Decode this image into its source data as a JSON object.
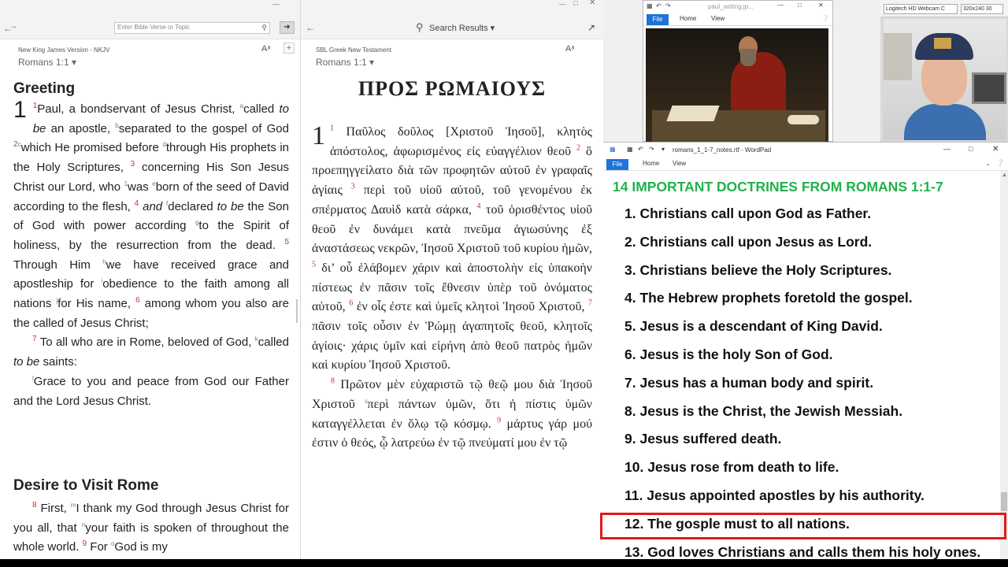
{
  "nkjv": {
    "search_placeholder": "Enter Bible Verse or Topic",
    "version": "New King James Version - NKJV",
    "reference": "Romans 1:1 ▾",
    "font_icon": "Aᵃ",
    "heading1": "Greeting",
    "heading2": "Desire to Visit Rome",
    "chapter": "1",
    "p1": [
      {
        "t": "vn",
        "v": "1"
      },
      {
        "t": "s",
        "v": "Paul, a bondservant of Jesus Christ, "
      },
      {
        "t": "fn",
        "v": "a"
      },
      {
        "t": "s",
        "v": "called "
      },
      {
        "t": "i",
        "v": "to be"
      },
      {
        "t": "s",
        "v": " an apostle, "
      },
      {
        "t": "fn",
        "v": "b"
      },
      {
        "t": "s",
        "v": "separated to the gospel of God "
      },
      {
        "t": "vn",
        "v": "2"
      },
      {
        "t": "fn",
        "v": "c"
      },
      {
        "t": "s",
        "v": "which He promised before "
      },
      {
        "t": "fn",
        "v": "d"
      },
      {
        "t": "s",
        "v": "through His prophets in the Holy Scriptures, "
      },
      {
        "t": "vn",
        "v": "3"
      },
      {
        "t": "s",
        "v": " concerning His Son Jesus Christ our Lord, who "
      },
      {
        "t": "fn",
        "v": "1"
      },
      {
        "t": "s",
        "v": "was "
      },
      {
        "t": "fn",
        "v": "e"
      },
      {
        "t": "s",
        "v": "born of the seed of David according to the flesh, "
      },
      {
        "t": "vn",
        "v": "4"
      },
      {
        "t": "i",
        "v": " and "
      },
      {
        "t": "fn",
        "v": "f"
      },
      {
        "t": "s",
        "v": "declared "
      },
      {
        "t": "i",
        "v": "to be"
      },
      {
        "t": "s",
        "v": " the Son of God with power according "
      },
      {
        "t": "fn",
        "v": "g"
      },
      {
        "t": "s",
        "v": "to the Spirit of holiness, by the resurrection from the dead. "
      },
      {
        "t": "vn",
        "v": "5"
      },
      {
        "t": "s",
        "v": " Through Him "
      },
      {
        "t": "fn",
        "v": "h"
      },
      {
        "t": "s",
        "v": "we have received grace and apostleship for "
      },
      {
        "t": "fn",
        "v": "i"
      },
      {
        "t": "s",
        "v": "obedience to the faith among all nations "
      },
      {
        "t": "fn",
        "v": "j"
      },
      {
        "t": "s",
        "v": "for His name, "
      },
      {
        "t": "vn",
        "v": "6"
      },
      {
        "t": "s",
        "v": " among whom you also are the called of Jesus Christ;"
      }
    ],
    "p2": [
      {
        "t": "vn",
        "v": "7"
      },
      {
        "t": "s",
        "v": " To all who are in Rome, beloved of God, "
      },
      {
        "t": "fn",
        "v": "k"
      },
      {
        "t": "s",
        "v": "called "
      },
      {
        "t": "i",
        "v": "to be"
      },
      {
        "t": "s",
        "v": " saints:"
      }
    ],
    "p3": [
      {
        "t": "fn",
        "v": "l"
      },
      {
        "t": "s",
        "v": "Grace to you and peace from God our Father and the Lord Jesus Christ."
      }
    ],
    "p4": [
      {
        "t": "vn",
        "v": "8"
      },
      {
        "t": "s",
        "v": " First, "
      },
      {
        "t": "fn",
        "v": "m"
      },
      {
        "t": "s",
        "v": "I thank my God through Jesus Christ for you all, that "
      },
      {
        "t": "fn",
        "v": "n"
      },
      {
        "t": "s",
        "v": "your faith is spoken of throughout the whole world. "
      },
      {
        "t": "vn",
        "v": "9"
      },
      {
        "t": "s",
        "v": " For "
      },
      {
        "t": "fn",
        "v": "o"
      },
      {
        "t": "s",
        "v": "God is my"
      }
    ]
  },
  "greek": {
    "search_label": "Search Results ▾",
    "version": "SBL Greek New Testament",
    "reference": "Romans 1:1 ▾",
    "title": "ΠΡΟΣ ΡΩΜΑΙΟΥΣ",
    "chapter": "1",
    "p1": [
      {
        "t": "vn",
        "v": "1"
      },
      {
        "t": "s",
        "v": " Παῦλος δοῦλος [Χριστοῦ Ἰησοῦ], κλητὸς ἀπόστολος, ἀφωρισμένος εἰς εὐαγγέλιον θεοῦ "
      },
      {
        "t": "vn",
        "v": "2"
      },
      {
        "t": "s",
        "v": " ὃ προεπηγγείλατο διὰ τῶν προφητῶν αὐτοῦ ἐν γραφαῖς ἁγίαις "
      },
      {
        "t": "vn",
        "v": "3"
      },
      {
        "t": "s",
        "v": " περὶ τοῦ υἱοῦ αὐτοῦ, τοῦ γενομένου ἐκ σπέρματος Δαυὶδ κατὰ σάρκα, "
      },
      {
        "t": "vn",
        "v": "4"
      },
      {
        "t": "s",
        "v": " τοῦ ὁρισθέντος υἱοῦ θεοῦ ἐν δυνάμει κατὰ πνεῦμα ἁγιωσύνης ἐξ ἀναστάσεως νεκρῶν, Ἰησοῦ Χριστοῦ τοῦ κυρίου ἡμῶν, "
      },
      {
        "t": "vn",
        "v": "5"
      },
      {
        "t": "s",
        "v": " δι’ οὗ ἐλάβομεν χάριν καὶ ἀποστολὴν εἰς ὑπακοὴν πίστεως ἐν πᾶσιν τοῖς ἔθνεσιν ὑπὲρ τοῦ ὀνόματος αὐτοῦ, "
      },
      {
        "t": "vn",
        "v": "6"
      },
      {
        "t": "s",
        "v": " ἐν οἷς ἐστε καὶ ὑμεῖς κλητοὶ Ἰησοῦ Χριστοῦ, "
      },
      {
        "t": "vn",
        "v": "7"
      },
      {
        "t": "s",
        "v": " πᾶσιν τοῖς οὖσιν ἐν Ῥώμῃ ἀγαπητοῖς θεοῦ, κλητοῖς ἁγίοις· χάρις ὑμῖν καὶ εἰρήνη ἀπὸ θεοῦ πατρὸς ἡμῶν καὶ κυρίου Ἰησοῦ Χριστοῦ."
      }
    ],
    "p2": [
      {
        "t": "vn",
        "v": "8"
      },
      {
        "t": "s",
        "v": " Πρῶτον μὲν εὐχαριστῶ τῷ θεῷ μου διὰ Ἰησοῦ Χριστοῦ "
      },
      {
        "t": "fn",
        "v": "a"
      },
      {
        "t": "s",
        "v": "περὶ πάντων ὑμῶν, ὅτι ἡ πίστις ὑμῶν καταγγέλλεται ἐν ὅλῳ τῷ κόσμῳ. "
      },
      {
        "t": "vn",
        "v": "9"
      },
      {
        "t": "s",
        "v": " μάρτυς γάρ μού ἐστιν ὁ θεός, ᾧ λατρεύω ἐν τῷ πνεύματί μου ἐν τῷ"
      }
    ]
  },
  "photo_window": {
    "title": "paul_writing.jp...",
    "tab_file": "File",
    "tab_home": "Home",
    "tab_view": "View"
  },
  "webcam": {
    "device": "Logitech HD Webcam C",
    "resolution": "320x240 30"
  },
  "wordpad": {
    "title": "romans_1_1-7_notes.rtf - WordPad",
    "tab_file": "File",
    "tab_home": "Home",
    "tab_view": "View",
    "doc_title": "14 IMPORTANT DOCTRINES FROM ROMANS 1:1-7",
    "items": [
      "1. Christians call upon God as Father.",
      "2. Christians call upon Jesus as Lord.",
      "3. Christians believe the Holy Scriptures.",
      "4. The Hebrew prophets foretold the gospel.",
      "5. Jesus is a descendant of King David.",
      "6. Jesus is the holy Son of God.",
      "7. Jesus has a human body and spirit.",
      "8. Jesus is the Christ, the Jewish Messiah.",
      "9. Jesus suffered death.",
      "10. Jesus rose from death to life.",
      "11. Jesus appointed apostles by his authority.",
      "12. The gosple must to all nations.",
      "13. God loves Christians and calls them his holy ones."
    ],
    "highlighted_index": 11
  },
  "colors": {
    "verse_number": "#c0392b",
    "doc_title_green": "#22b14c",
    "highlight_red": "#e01a1a",
    "file_tab_blue": "#1e74d8"
  }
}
